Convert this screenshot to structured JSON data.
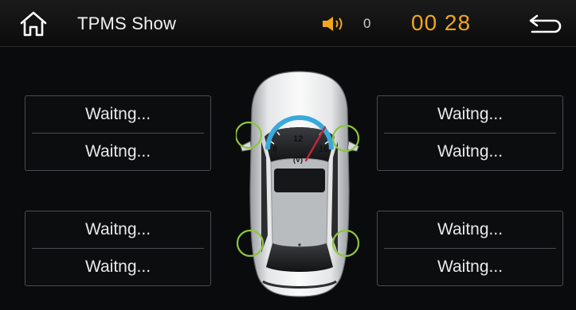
{
  "header": {
    "title": "TPMS Show",
    "volume_level": "0",
    "clock": "00 28"
  },
  "tires": {
    "front_left": {
      "pressure": "Waitng...",
      "temperature": "Waitng..."
    },
    "front_right": {
      "pressure": "Waitng...",
      "temperature": "Waitng..."
    },
    "rear_left": {
      "pressure": "Waitng...",
      "temperature": "Waitng..."
    },
    "rear_right": {
      "pressure": "Waitng...",
      "temperature": "Waitng..."
    }
  },
  "gauge": {
    "label_min": "8",
    "label_mid": "12",
    "label_max": "16",
    "unit": "(V)",
    "voltage": 14.5
  },
  "icons": {
    "home": "home-icon",
    "volume": "speaker-icon",
    "back": "return-arrow-icon"
  },
  "colors": {
    "accent_clock": "#f2a51d",
    "tire_ring": "#8cc63f",
    "gauge_blue": "#39a9dc",
    "needle_red": "#c0273b"
  }
}
